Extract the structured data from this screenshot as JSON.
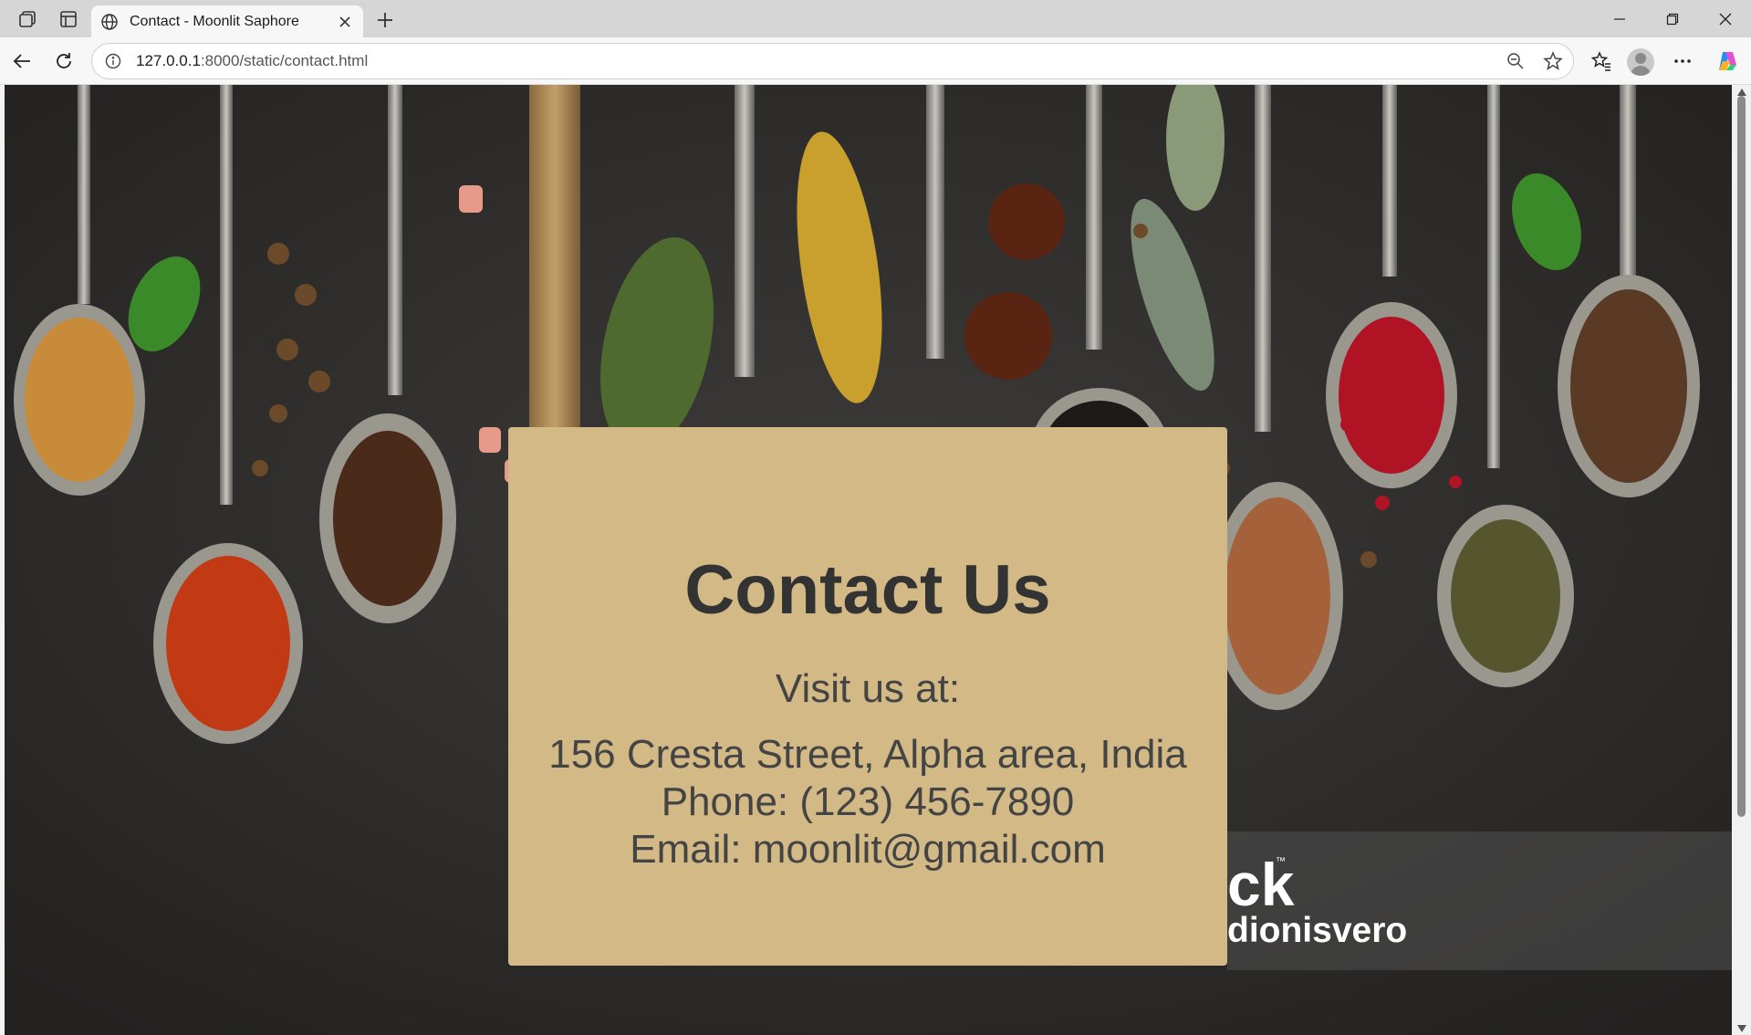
{
  "browser": {
    "tab_title": "Contact - Moonlit Saphore",
    "url_host": "127.0.0.1",
    "url_rest": ":8000/static/contact.html",
    "icons": [
      "workspaces-icon",
      "vertical-tabs-icon",
      "globe-icon",
      "close-tab-icon",
      "new-tab-icon",
      "minimize-icon",
      "restore-icon",
      "close-window-icon",
      "back-icon",
      "refresh-icon",
      "site-info-icon",
      "zoom-out-icon",
      "favorite-star-icon",
      "favorites-icon",
      "profile-avatar-icon",
      "more-icon",
      "copilot-icon"
    ]
  },
  "page": {
    "title": "Contact Us",
    "visit_label": "Visit us at:",
    "address": "156 Cresta Street, Alpha area, India",
    "phone": "Phone: (123) 456-7890",
    "email": "Email: moonlit@gmail.com"
  },
  "background": {
    "watermark_logo": "ck",
    "watermark_tm": "™",
    "watermark_user": "dionisvero"
  },
  "colors": {
    "card": "#d2b985",
    "heading": "#333333",
    "text": "#444444",
    "background": "#2e2d2c"
  }
}
